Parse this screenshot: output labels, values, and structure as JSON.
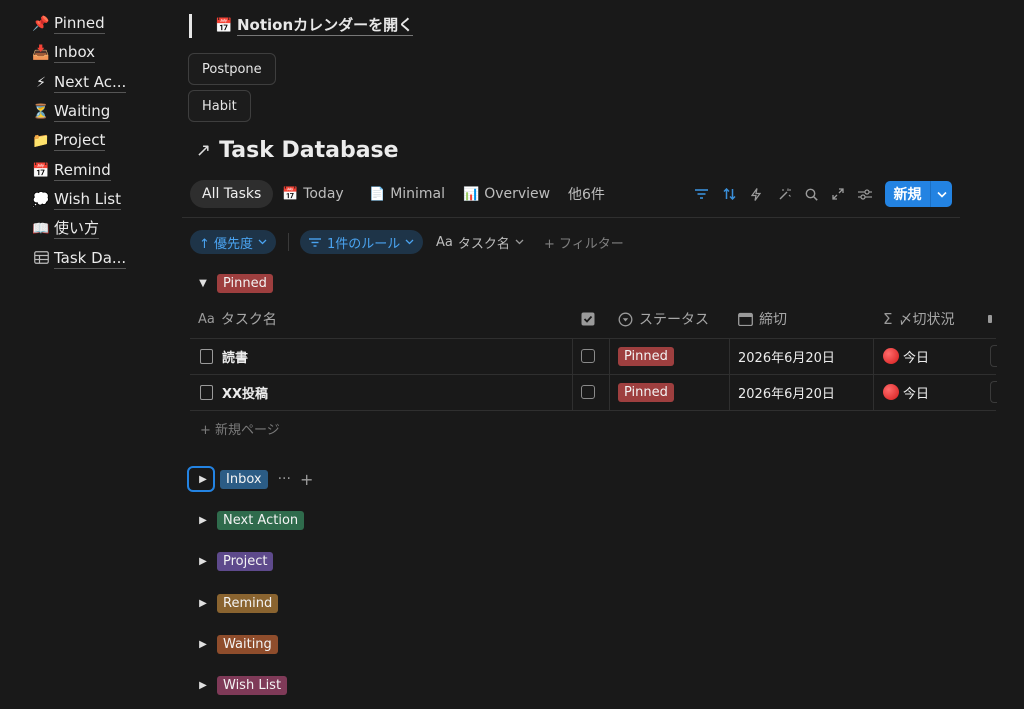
{
  "sidebar": {
    "items": [
      {
        "icon": "📌",
        "label": "Pinned"
      },
      {
        "icon": "📥",
        "label": "Inbox"
      },
      {
        "icon": "⚡",
        "label": "Next Ac..."
      },
      {
        "icon": "⏳",
        "label": "Waiting"
      },
      {
        "icon": "📁",
        "label": "Project"
      },
      {
        "icon": "📅",
        "label": "Remind"
      },
      {
        "icon": "💭",
        "label": "Wish List"
      },
      {
        "icon": "📖",
        "label": "使い方"
      },
      {
        "icon": "table-icon",
        "label": "Task Da..."
      }
    ]
  },
  "top_link": {
    "icon": "📅",
    "label": "Notionカレンダーを開く"
  },
  "buttons": {
    "postpone": "Postpone",
    "habit": "Habit"
  },
  "database": {
    "title": "Task Database",
    "title_icon": "↗"
  },
  "tabs": [
    {
      "icon": "",
      "label": "All Tasks"
    },
    {
      "icon": "📅",
      "label": "Today"
    },
    {
      "icon": "📄",
      "label": "Minimal"
    },
    {
      "icon": "📊",
      "label": "Overview"
    },
    {
      "icon": "",
      "label": "他6件"
    }
  ],
  "toolbar": {
    "new_label": "新規"
  },
  "filters": {
    "priority": "↑ 優先度",
    "rules": "1件のルール",
    "task_name": "タスク名",
    "task_name_prefix": "Aa",
    "add_filter": "+ フィルター"
  },
  "groups": {
    "pinned": {
      "label": "Pinned",
      "color": "#9e3f3f"
    },
    "inbox": {
      "label": "Inbox",
      "color": "#2b5c85"
    },
    "next_action": {
      "label": "Next Action",
      "color": "#2f6b4c"
    },
    "project": {
      "label": "Project",
      "color": "#5e4a8c"
    },
    "remind": {
      "label": "Remind",
      "color": "#8a6430"
    },
    "waiting": {
      "label": "Waiting",
      "color": "#8f4d2c"
    },
    "wish_list": {
      "label": "Wish List",
      "color": "#7f3a58"
    }
  },
  "table": {
    "columns": {
      "name": {
        "icon": "Aa",
        "label": "タスク名"
      },
      "status": {
        "label": "ステータス"
      },
      "deadline": {
        "label": "締切"
      },
      "deadline_state": {
        "icon": "Σ",
        "label": "〆切状況"
      }
    },
    "rows": [
      {
        "name": "読書",
        "status": "Pinned",
        "deadline": "2026年6月20日",
        "deadline_state": "今日"
      },
      {
        "name": "XX投稿",
        "status": "Pinned",
        "deadline": "2026年6月20日",
        "deadline_state": "今日"
      }
    ],
    "new_page": "+ 新規ページ"
  }
}
